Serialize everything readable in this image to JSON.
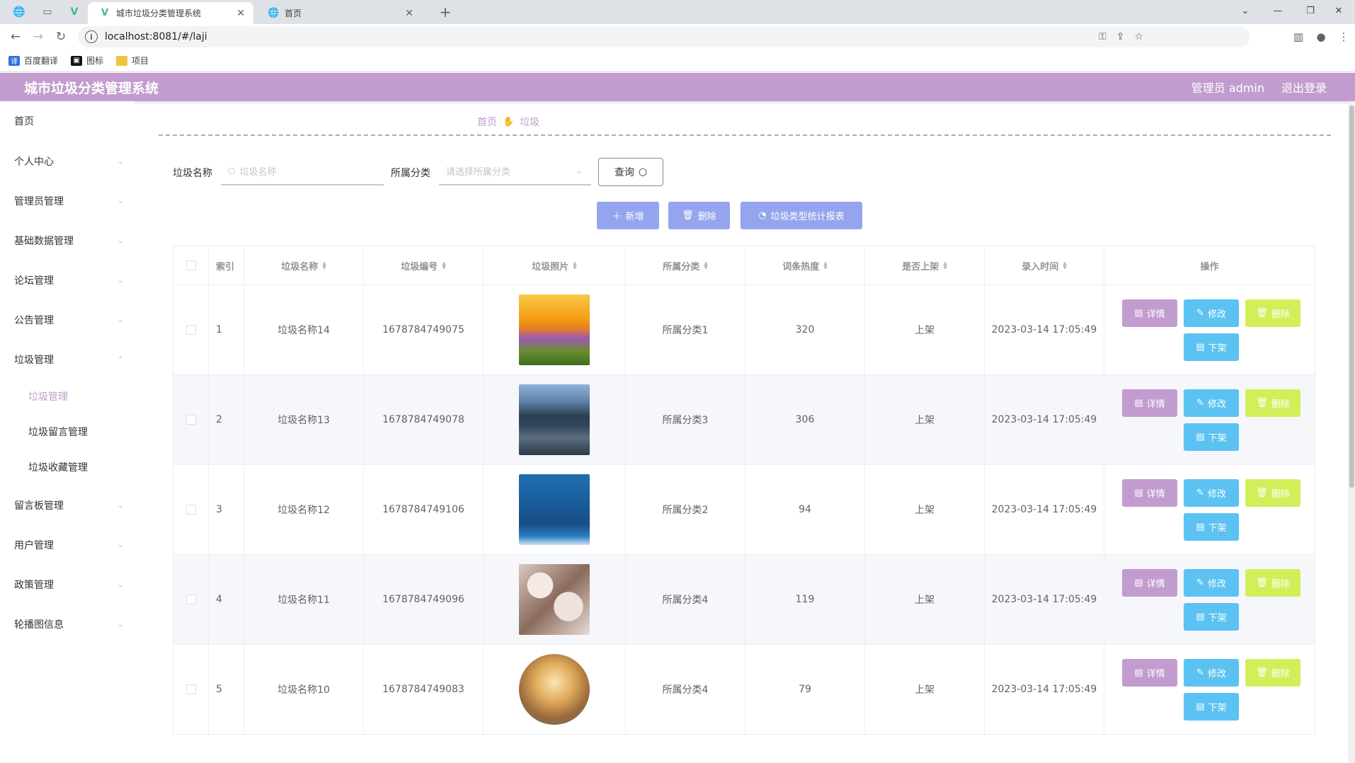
{
  "browser": {
    "tabs": [
      {
        "title": "城市垃圾分类管理系统",
        "active": true
      },
      {
        "title": "首页",
        "active": false
      }
    ],
    "url": "localhost:8081/#/laji",
    "bookmarks": [
      "百度翻译",
      "图标",
      "项目"
    ]
  },
  "header": {
    "title": "城市垃圾分类管理系统",
    "user": "管理员 admin",
    "logout": "退出登录"
  },
  "sidebar": {
    "items": [
      {
        "label": "首页"
      },
      {
        "label": "个人中心"
      },
      {
        "label": "管理员管理"
      },
      {
        "label": "基础数据管理"
      },
      {
        "label": "论坛管理"
      },
      {
        "label": "公告管理"
      },
      {
        "label": "垃圾管理"
      },
      {
        "label": "留言板管理"
      },
      {
        "label": "用户管理"
      },
      {
        "label": "政策管理"
      },
      {
        "label": "轮播图信息"
      }
    ],
    "subitems": [
      {
        "label": "垃圾管理",
        "active": true
      },
      {
        "label": "垃圾留言管理"
      },
      {
        "label": "垃圾收藏管理"
      }
    ]
  },
  "breadcrumb": {
    "home": "首页",
    "current": "垃圾"
  },
  "search": {
    "name_label": "垃圾名称",
    "name_placeholder": "垃圾名称",
    "category_label": "所属分类",
    "category_placeholder": "请选择所属分类",
    "query_label": "查询"
  },
  "actions": {
    "add": "新增",
    "delete": "删除",
    "report": "垃圾类型统计报表"
  },
  "table": {
    "headers": {
      "index": "索引",
      "name": "垃圾名称",
      "code": "垃圾编号",
      "photo": "垃圾照片",
      "category": "所属分类",
      "heat": "词条热度",
      "listed": "是否上架",
      "time": "录入时间",
      "ops": "操作"
    },
    "row_buttons": {
      "detail": "详情",
      "edit": "修改",
      "delete": "删除",
      "unlist": "下架"
    },
    "rows": [
      {
        "index": "1",
        "name": "垃圾名称14",
        "code": "1678784749075",
        "photo": "sunset-meadow",
        "category": "所属分类1",
        "heat": "320",
        "listed": "上架",
        "time": "2023-03-14 17:05:49"
      },
      {
        "index": "2",
        "name": "垃圾名称13",
        "code": "1678784749078",
        "photo": "mountain-city",
        "category": "所属分类3",
        "heat": "306",
        "listed": "上架",
        "time": "2023-03-14 17:05:49"
      },
      {
        "index": "3",
        "name": "垃圾名称12",
        "code": "1678784749106",
        "photo": "ocean-figure",
        "category": "所属分类2",
        "heat": "94",
        "listed": "上架",
        "time": "2023-03-14 17:05:49"
      },
      {
        "index": "4",
        "name": "垃圾名称11",
        "code": "1678784749096",
        "photo": "blossoms",
        "category": "所属分类4",
        "heat": "119",
        "listed": "上架",
        "time": "2023-03-14 17:05:49"
      },
      {
        "index": "5",
        "name": "垃圾名称10",
        "code": "1678784749083",
        "photo": "desert-globe",
        "category": "所属分类4",
        "heat": "79",
        "listed": "上架",
        "time": "2023-03-14 17:05:49"
      }
    ]
  },
  "colors": {
    "accent": "#c39ccf",
    "action": "#94a5ee",
    "edit": "#5cc2f2",
    "delete": "#d2ef5a"
  }
}
